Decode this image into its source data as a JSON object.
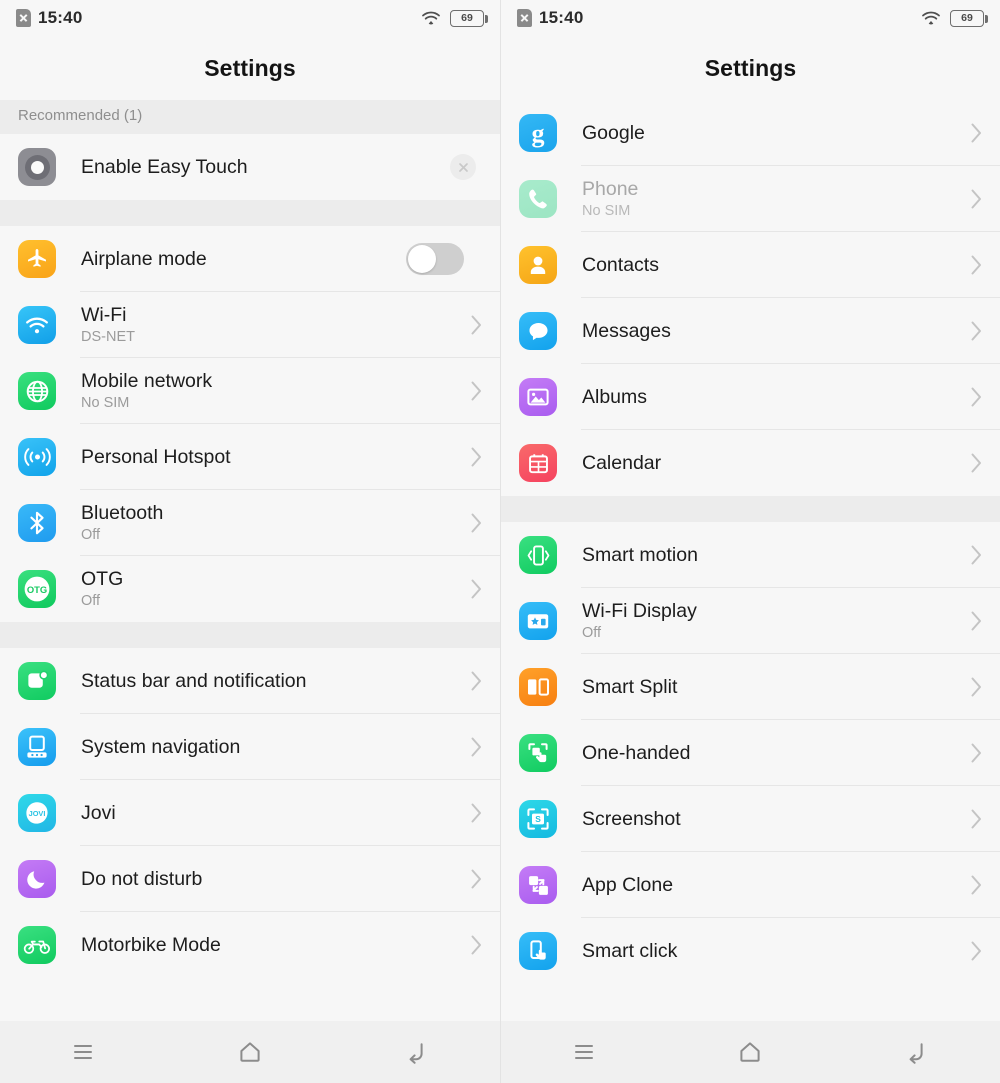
{
  "screens": [
    {
      "status_bar": {
        "sim_icon": "sim-no-service-icon",
        "time": "15:40",
        "wifi_icon": "wifi-icon",
        "battery_level": "69"
      },
      "header": {
        "title": "Settings"
      },
      "sections": [
        {
          "header": "Recommended (1)",
          "rows": [
            {
              "name": "enable-easy-touch",
              "icon": "easy-touch-icon",
              "title": "Enable Easy Touch",
              "sub": "",
              "accessory": "dismiss"
            }
          ]
        },
        {
          "header": "",
          "rows": [
            {
              "name": "airplane-mode",
              "icon": "airplane-icon",
              "title": "Airplane mode",
              "sub": "",
              "accessory": "toggle",
              "toggle_on": false
            },
            {
              "name": "wifi",
              "icon": "wifi-tile-icon",
              "title": "Wi-Fi",
              "sub": "DS-NET",
              "accessory": "chevron"
            },
            {
              "name": "mobile-network",
              "icon": "globe-icon",
              "title": "Mobile network",
              "sub": "No SIM",
              "accessory": "chevron"
            },
            {
              "name": "personal-hotspot",
              "icon": "hotspot-icon",
              "title": "Personal Hotspot",
              "sub": "",
              "accessory": "chevron"
            },
            {
              "name": "bluetooth",
              "icon": "bluetooth-icon",
              "title": "Bluetooth",
              "sub": "Off",
              "accessory": "chevron"
            },
            {
              "name": "otg",
              "icon": "otg-icon",
              "title": "OTG",
              "sub": "Off",
              "accessory": "chevron"
            }
          ]
        },
        {
          "header": "",
          "rows": [
            {
              "name": "status-bar-and-notification",
              "icon": "notification-icon",
              "title": "Status bar and notification",
              "sub": "",
              "accessory": "chevron"
            },
            {
              "name": "system-navigation",
              "icon": "navigation-icon",
              "title": "System navigation",
              "sub": "",
              "accessory": "chevron"
            },
            {
              "name": "jovi",
              "icon": "jovi-icon",
              "title": "Jovi",
              "sub": "",
              "accessory": "chevron"
            },
            {
              "name": "do-not-disturb",
              "icon": "moon-icon",
              "title": "Do not disturb",
              "sub": "",
              "accessory": "chevron"
            },
            {
              "name": "motorbike-mode",
              "icon": "motorbike-icon",
              "title": "Motorbike Mode",
              "sub": "",
              "accessory": "chevron"
            }
          ]
        }
      ],
      "nav_bar": {
        "recents": "menu-icon",
        "home": "home-icon",
        "back": "back-icon"
      }
    },
    {
      "status_bar": {
        "sim_icon": "sim-no-service-icon",
        "time": "15:40",
        "wifi_icon": "wifi-icon",
        "battery_level": "69"
      },
      "header": {
        "title": "Settings"
      },
      "sections": [
        {
          "header": "",
          "rows": [
            {
              "name": "google",
              "icon": "google-icon",
              "title": "Google",
              "sub": "",
              "accessory": "chevron"
            },
            {
              "name": "phone",
              "icon": "phone-icon",
              "title": "Phone",
              "sub": "No SIM",
              "accessory": "chevron",
              "disabled": true
            },
            {
              "name": "contacts",
              "icon": "contacts-icon",
              "title": "Contacts",
              "sub": "",
              "accessory": "chevron"
            },
            {
              "name": "messages",
              "icon": "messages-icon",
              "title": "Messages",
              "sub": "",
              "accessory": "chevron"
            },
            {
              "name": "albums",
              "icon": "albums-icon",
              "title": "Albums",
              "sub": "",
              "accessory": "chevron"
            },
            {
              "name": "calendar",
              "icon": "calendar-icon",
              "title": "Calendar",
              "sub": "",
              "accessory": "chevron"
            }
          ]
        },
        {
          "header": "",
          "rows": [
            {
              "name": "smart-motion",
              "icon": "smart-motion-icon",
              "title": "Smart motion",
              "sub": "",
              "accessory": "chevron"
            },
            {
              "name": "wifi-display",
              "icon": "wifi-display-icon",
              "title": "Wi-Fi Display",
              "sub": "Off",
              "accessory": "chevron"
            },
            {
              "name": "smart-split",
              "icon": "smart-split-icon",
              "title": "Smart Split",
              "sub": "",
              "accessory": "chevron"
            },
            {
              "name": "one-handed",
              "icon": "one-handed-icon",
              "title": "One-handed",
              "sub": "",
              "accessory": "chevron"
            },
            {
              "name": "screenshot",
              "icon": "screenshot-icon",
              "title": "Screenshot",
              "sub": "",
              "accessory": "chevron"
            },
            {
              "name": "app-clone",
              "icon": "app-clone-icon",
              "title": "App Clone",
              "sub": "",
              "accessory": "chevron"
            },
            {
              "name": "smart-click",
              "icon": "smart-click-icon",
              "title": "Smart click",
              "sub": "",
              "accessory": "chevron"
            }
          ]
        }
      ],
      "nav_bar": {
        "recents": "menu-icon",
        "home": "home-icon",
        "back": "back-icon"
      }
    }
  ],
  "colors": {
    "row_bg": "#f7f7f7",
    "gap_bg": "#ececec",
    "divider": "#e6e6e6",
    "title_text": "#1d1d1d",
    "sub_text": "#9b9b9b",
    "nav_bg": "#f0f0f0"
  }
}
